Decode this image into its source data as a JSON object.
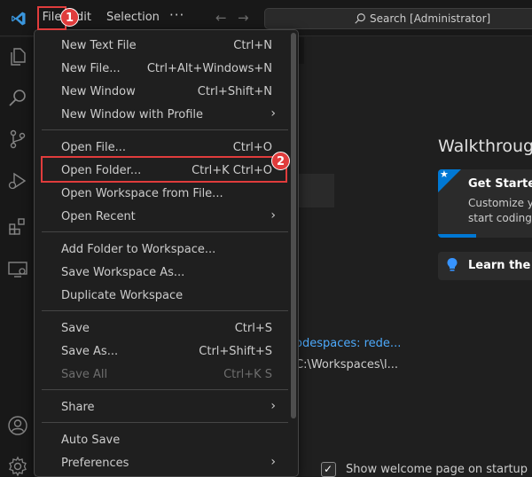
{
  "titlebar": {
    "menus": {
      "file": "File",
      "edit": "dit",
      "selection": "Selection",
      "more": "···"
    },
    "search_text": "Search [Administrator]"
  },
  "file_menu": {
    "items": [
      {
        "label": "New Text File",
        "shortcut": "Ctrl+N"
      },
      {
        "label": "New File...",
        "shortcut": "Ctrl+Alt+Windows+N"
      },
      {
        "label": "New Window",
        "shortcut": "Ctrl+Shift+N"
      },
      {
        "label": "New Window with Profile",
        "shortcut": ""
      },
      {
        "label": "Open File...",
        "shortcut": "Ctrl+O"
      },
      {
        "label": "Open Folder...",
        "shortcut": "Ctrl+K Ctrl+O"
      },
      {
        "label": "Open Workspace from File...",
        "shortcut": ""
      },
      {
        "label": "Open Recent",
        "shortcut": ""
      },
      {
        "label": "Add Folder to Workspace...",
        "shortcut": ""
      },
      {
        "label": "Save Workspace As...",
        "shortcut": ""
      },
      {
        "label": "Duplicate Workspace",
        "shortcut": ""
      },
      {
        "label": "Save",
        "shortcut": "Ctrl+S"
      },
      {
        "label": "Save As...",
        "shortcut": "Ctrl+Shift+S"
      },
      {
        "label": "Save All",
        "shortcut": "Ctrl+K S"
      },
      {
        "label": "Share",
        "shortcut": ""
      },
      {
        "label": "Auto Save",
        "shortcut": ""
      },
      {
        "label": "Preferences",
        "shortcut": ""
      }
    ]
  },
  "welcome": {
    "walkthroughs_title": "Walkthrougl",
    "get_started_title": "Get Started",
    "get_started_line1": "Customize y",
    "get_started_line2": "start coding",
    "learn_title": "Learn the Fu",
    "recent_link": "odespaces: rede...",
    "recent_path": "C:\\Workspaces\\l...",
    "show_welcome_label": "Show welcome page on startup"
  },
  "annotations": {
    "badge1": "1",
    "badge2": "2"
  },
  "colors": {
    "accent": "#0078d4",
    "highlight": "#e03c3c",
    "link": "#4daafc"
  }
}
